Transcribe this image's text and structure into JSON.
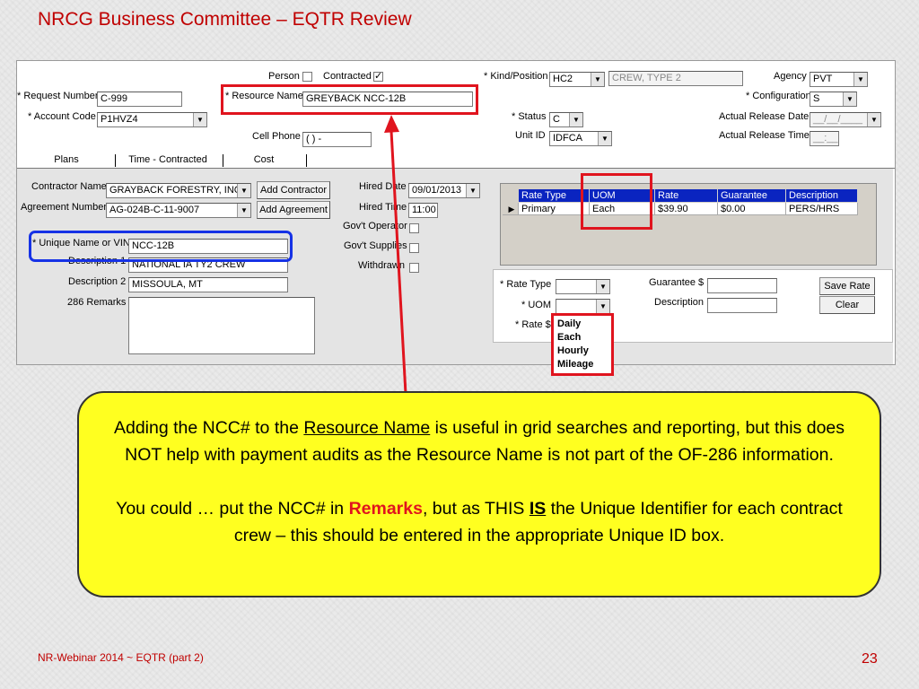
{
  "slide": {
    "title": "NRCG Business Committee – EQTR Review",
    "footer": "NR-Webinar 2014 ~ EQTR (part 2)",
    "page_number": "23"
  },
  "form": {
    "top": {
      "person_label": "Person",
      "contracted_label": "Contracted",
      "contracted_checked": "✓",
      "kind_position_label": "* Kind/Position",
      "kind_position_code": "HC2",
      "kind_position_desc": "CREW, TYPE 2",
      "agency_label": "Agency",
      "agency_value": "PVT",
      "request_number_label": "* Request Number",
      "request_number_value": "C-999",
      "resource_name_label": "* Resource Name",
      "resource_name_value": "GREYBACK NCC-12B",
      "configuration_label": "* Configuration",
      "configuration_value": "S",
      "account_code_label": "* Account Code",
      "account_code_value": "P1HVZ4",
      "status_label": "* Status",
      "status_value": "C",
      "actual_release_date_label": "Actual Release Date",
      "actual_release_date_value": "__/__/____",
      "cell_phone_label": "Cell Phone",
      "cell_phone_value": "( )   -",
      "unit_id_label": "Unit ID",
      "unit_id_value": "IDFCA",
      "actual_release_time_label": "Actual Release Time",
      "actual_release_time_value": "__:__"
    },
    "tabs": [
      "Plans",
      "Time - Contracted",
      "Cost"
    ],
    "contract": {
      "contractor_name_label": "Contractor Name",
      "contractor_name_value": "GRAYBACK FORESTRY, INC",
      "add_contractor_button": "Add Contractor",
      "agreement_number_label": "Agreement Number",
      "agreement_number_value": "AG-024B-C-11-9007",
      "add_agreement_button": "Add Agreement",
      "unique_name_label": "* Unique Name or VIN",
      "unique_name_value": "NCC-12B",
      "description1_label": "Description 1",
      "description1_value": "NATIONAL IA TY2 CREW",
      "description2_label": "Description 2",
      "description2_value": "MISSOULA, MT",
      "remarks_label": "286 Remarks",
      "remarks_value": "",
      "hired_date_label": "Hired Date",
      "hired_date_value": "09/01/2013",
      "hired_time_label": "Hired Time",
      "hired_time_value": "11:00",
      "govt_operator_label": "Gov't Operator",
      "govt_supplies_label": "Gov't Supplies",
      "withdrawn_label": "Withdrawn"
    },
    "rate_grid": {
      "columns": [
        "Rate Type",
        "UOM",
        "Rate",
        "Guarantee",
        "Description"
      ],
      "rows": [
        {
          "rate_type": "Primary",
          "uom": "Each",
          "rate": "$39.90",
          "guarantee": "$0.00",
          "description": "PERS/HRS"
        }
      ]
    },
    "rate_edit": {
      "rate_type_label": "* Rate Type",
      "uom_label": "* UOM",
      "rate_label": "* Rate $",
      "guarantee_label": "Guarantee $",
      "description_label": "Description",
      "save_rate_button": "Save Rate",
      "clear_button": "Clear"
    },
    "uom_options": [
      "Daily",
      "Each",
      "Hourly",
      "Mileage"
    ]
  },
  "callout": {
    "p1_before": "Adding the NCC# to the ",
    "p1_underlined": "Resource Name",
    "p1_after": " is useful in grid searches and reporting, but this does NOT help with payment audits as the Resource Name is not part of the OF-286 information.",
    "p2_before": "You could …  put the NCC# in ",
    "p2_remarks": "Remarks",
    "p2_middle": ", but as THIS ",
    "p2_is": "IS",
    "p2_after": " the Unique Identifier for each contract crew – this should be entered in the appropriate Unique ID box."
  },
  "colors": {
    "title_red": "#c00000",
    "highlight_red": "#e0141e",
    "highlight_blue": "#1632e6",
    "callout_yellow": "#ffff20",
    "grid_header_blue": "#0a24c0"
  },
  "icons": {
    "dropdown": "chevron-down-icon",
    "row_indicator": "row-pointer-icon",
    "arrow": "red-arrow-annotation"
  }
}
